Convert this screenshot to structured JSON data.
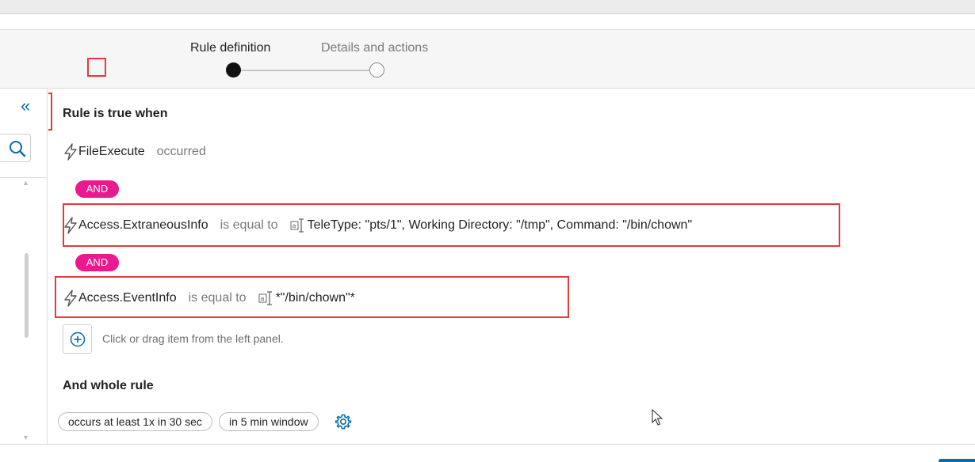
{
  "wizard": {
    "steps": [
      {
        "label": "Rule definition",
        "active": true
      },
      {
        "label": "Details and actions",
        "active": false
      }
    ]
  },
  "left_panel": {
    "collapse_icon": "double-chevron-left-icon",
    "search_icon": "search-icon"
  },
  "rule": {
    "title": "Rule is true when",
    "conditions": [
      {
        "field": "FileExecute",
        "operator": "occurred",
        "value": ""
      },
      {
        "connector": "AND",
        "field": "Access.ExtraneousInfo",
        "operator": "is equal to",
        "value": "TeleType: \"pts/1\", Working Directory: \"/tmp\", Command: \"/bin/chown\""
      },
      {
        "connector": "AND",
        "field": "Access.EventInfo",
        "operator": "is equal to",
        "value": "*\"/bin/chown\"*"
      }
    ],
    "add_hint": "Click or drag item from the left panel."
  },
  "whole_rule": {
    "title": "And whole rule",
    "occurrence": "occurs at least 1x in 30 sec",
    "window": "in 5 min window",
    "settings_icon": "gear-icon"
  },
  "colors": {
    "accent": "#0a6ba8",
    "and_badge": "#ea1a8e",
    "highlight": "#e23b3b"
  }
}
